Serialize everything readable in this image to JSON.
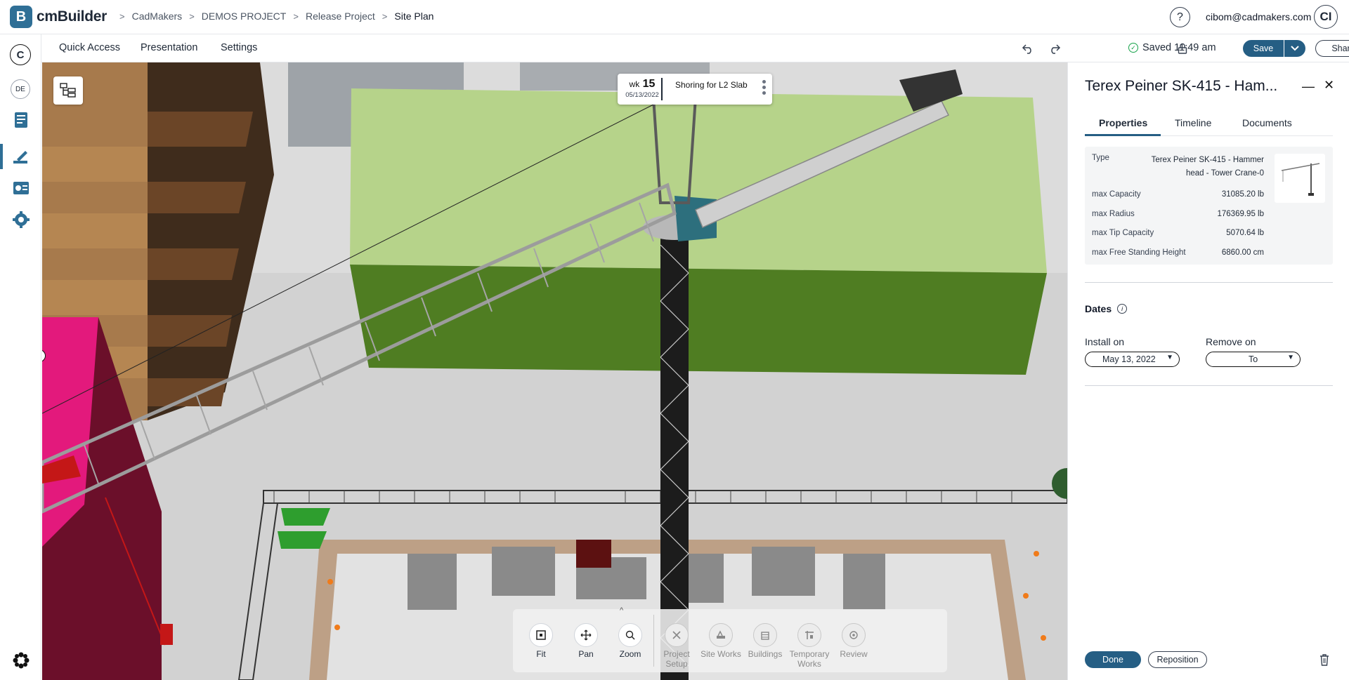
{
  "app": {
    "name": "cmBuilder",
    "logo_letter": "B"
  },
  "breadcrumb": [
    "CadMakers",
    "DEMOS PROJECT",
    "Release Project",
    "Site Plan"
  ],
  "header": {
    "help_glyph": "?",
    "user_email": "cibom@cadmakers.com",
    "avatar_initials": "CI"
  },
  "sidebar": {
    "company_initial": "C",
    "user_initials": "DE"
  },
  "menubar": {
    "items": [
      "Quick Access",
      "Presentation",
      "Settings"
    ],
    "saved_text": "Saved 11:49 am",
    "save_label": "Save",
    "share_label": "Share"
  },
  "schedule_card": {
    "wk_label": "wk",
    "wk_number": "15",
    "date": "05/13/2022",
    "activity": "Shoring for L2 Slab"
  },
  "toolbar": {
    "tools": [
      {
        "label": "Fit",
        "icon": "fit-icon"
      },
      {
        "label": "Pan",
        "icon": "pan-icon"
      },
      {
        "label": "Zoom",
        "icon": "zoom-icon"
      },
      {
        "label": "Project Setup",
        "icon": "project-setup-icon"
      },
      {
        "label": "Site Works",
        "icon": "site-works-icon"
      },
      {
        "label": "Buildings",
        "icon": "buildings-icon"
      },
      {
        "label": "Temporary Works",
        "icon": "temporary-works-icon"
      },
      {
        "label": "Review",
        "icon": "review-icon"
      }
    ]
  },
  "panel": {
    "title": "Terex Peiner SK-415 - Ham...",
    "tabs": [
      "Properties",
      "Timeline",
      "Documents"
    ],
    "properties": [
      {
        "label": "Type",
        "value": "Terex Peiner SK-415 - Hammer head - Tower Crane-0"
      },
      {
        "label": "max Capacity",
        "value": "31085.20 lb"
      },
      {
        "label": "max Radius",
        "value": "176369.95 lb"
      },
      {
        "label": "max Tip Capacity",
        "value": "5070.64 lb"
      },
      {
        "label": "max Free Standing Height",
        "value": "6860.00 cm"
      }
    ],
    "dates_label": "Dates",
    "install_label": "Install on",
    "install_value": "May 13, 2022",
    "remove_label": "Remove on",
    "remove_value": "To",
    "done_label": "Done",
    "reposition_label": "Reposition"
  },
  "colors": {
    "brand": "#255e84",
    "accent_green": "#16a34a",
    "magenta_building": "#6b0f2a"
  }
}
